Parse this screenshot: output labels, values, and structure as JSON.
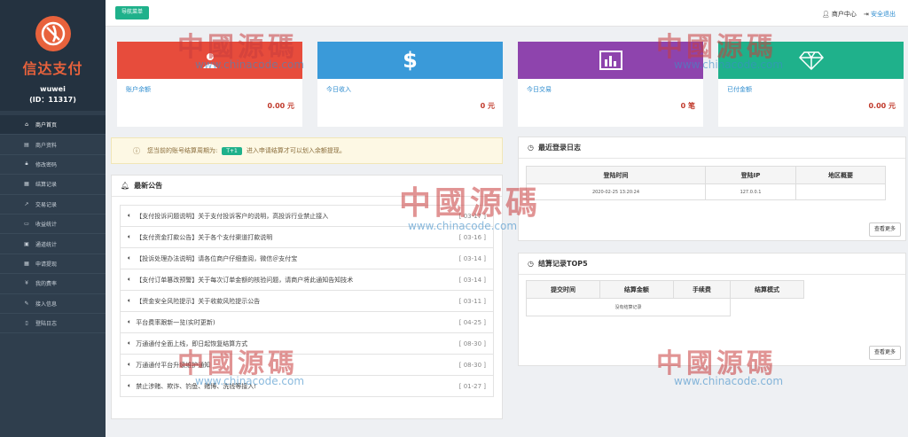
{
  "brand": {
    "name": "信达支付",
    "user": "wuwei",
    "user_id": "(ID：11317)",
    "color": "#e8623c"
  },
  "sidebar": {
    "items": [
      {
        "label": "商户首页",
        "icon": "home-icon",
        "active": true
      },
      {
        "label": "商户资料",
        "icon": "id-card-icon"
      },
      {
        "label": "修改密码",
        "icon": "lock-icon"
      },
      {
        "label": "结算记录",
        "icon": "calendar-icon"
      },
      {
        "label": "交易记录",
        "icon": "chart-icon"
      },
      {
        "label": "收益统计",
        "icon": "money-icon"
      },
      {
        "label": "通道统计",
        "icon": "calculator-icon"
      },
      {
        "label": "申请提现",
        "icon": "calendar-check-icon"
      },
      {
        "label": "我的费率",
        "icon": "yen-icon"
      },
      {
        "label": "接入信息",
        "icon": "wrench-icon"
      },
      {
        "label": "登陆日志",
        "icon": "file-icon"
      }
    ]
  },
  "topbar": {
    "nav_button": "导航菜单",
    "merchant_center": "商户中心",
    "logout": "安全退出"
  },
  "stats": [
    {
      "label": "账户余额",
      "value": "0.00 元",
      "color": "#e74c3c",
      "icon": "user-icon"
    },
    {
      "label": "今日收入",
      "value": "0 元",
      "color": "#3a9ad9",
      "icon": "dollar-icon"
    },
    {
      "label": "今日交易",
      "value": "0 笔",
      "color": "#8e44ad",
      "icon": "bar-chart-icon"
    },
    {
      "label": "已付金额",
      "value": "0.00 元",
      "color": "#1fb18b",
      "icon": "diamond-icon"
    }
  ],
  "notice": {
    "prefix": "您当前的账号结算周期为:",
    "badge": "T+1",
    "suffix": "进入申请结算才可以划入余额提现。"
  },
  "announcements": {
    "title": "最新公告",
    "items": [
      {
        "title": "【支付投诉问题说明】关于支付投诉客户的说明，高投诉行业禁止接入",
        "date": "[ 03-17 ]"
      },
      {
        "title": "【支付资金打款公告】关于各个支付渠道打款说明",
        "date": "[ 03-16 ]"
      },
      {
        "title": "【投诉处理办法说明】请各位商户仔细查阅，微信＠支付宝",
        "date": "[ 03-14 ]"
      },
      {
        "title": "【支付订单篡改预警】关于每次订单金额的核验问题，请商户将此通知告知技术",
        "date": "[ 03-14 ]"
      },
      {
        "title": "【资金安全风险提示】关于收款风险提示公告",
        "date": "[ 03-11 ]"
      },
      {
        "title": "平台费率跟新一览(实时更新)",
        "date": "[ 04-25 ]"
      },
      {
        "title": "万通通付全面上线，即日起恢复结算方式",
        "date": "[ 08-30 ]"
      },
      {
        "title": "万通通付平台升级维护通知",
        "date": "[ 08-30 ]"
      },
      {
        "title": "禁止涉赌、欺诈、钓鱼、赌博、洗钱等接入!",
        "date": "[ 01-27 ]"
      }
    ]
  },
  "login_log": {
    "title": "最近登录日志",
    "headers": [
      "登陆时间",
      "登陆IP",
      "地区概要"
    ],
    "rows": [
      [
        "2020-02-25 13:20:24",
        "127.0.0.1",
        ""
      ]
    ],
    "more": "查看更多"
  },
  "settlement": {
    "title": "结算记录TOP5",
    "headers": [
      "提交时间",
      "结算金额",
      "手续费",
      "结算模式"
    ],
    "empty": "没有结算记录",
    "more": "查看更多"
  },
  "watermark": {
    "cn": "中國源碼",
    "url": "www.chinacode.com"
  }
}
